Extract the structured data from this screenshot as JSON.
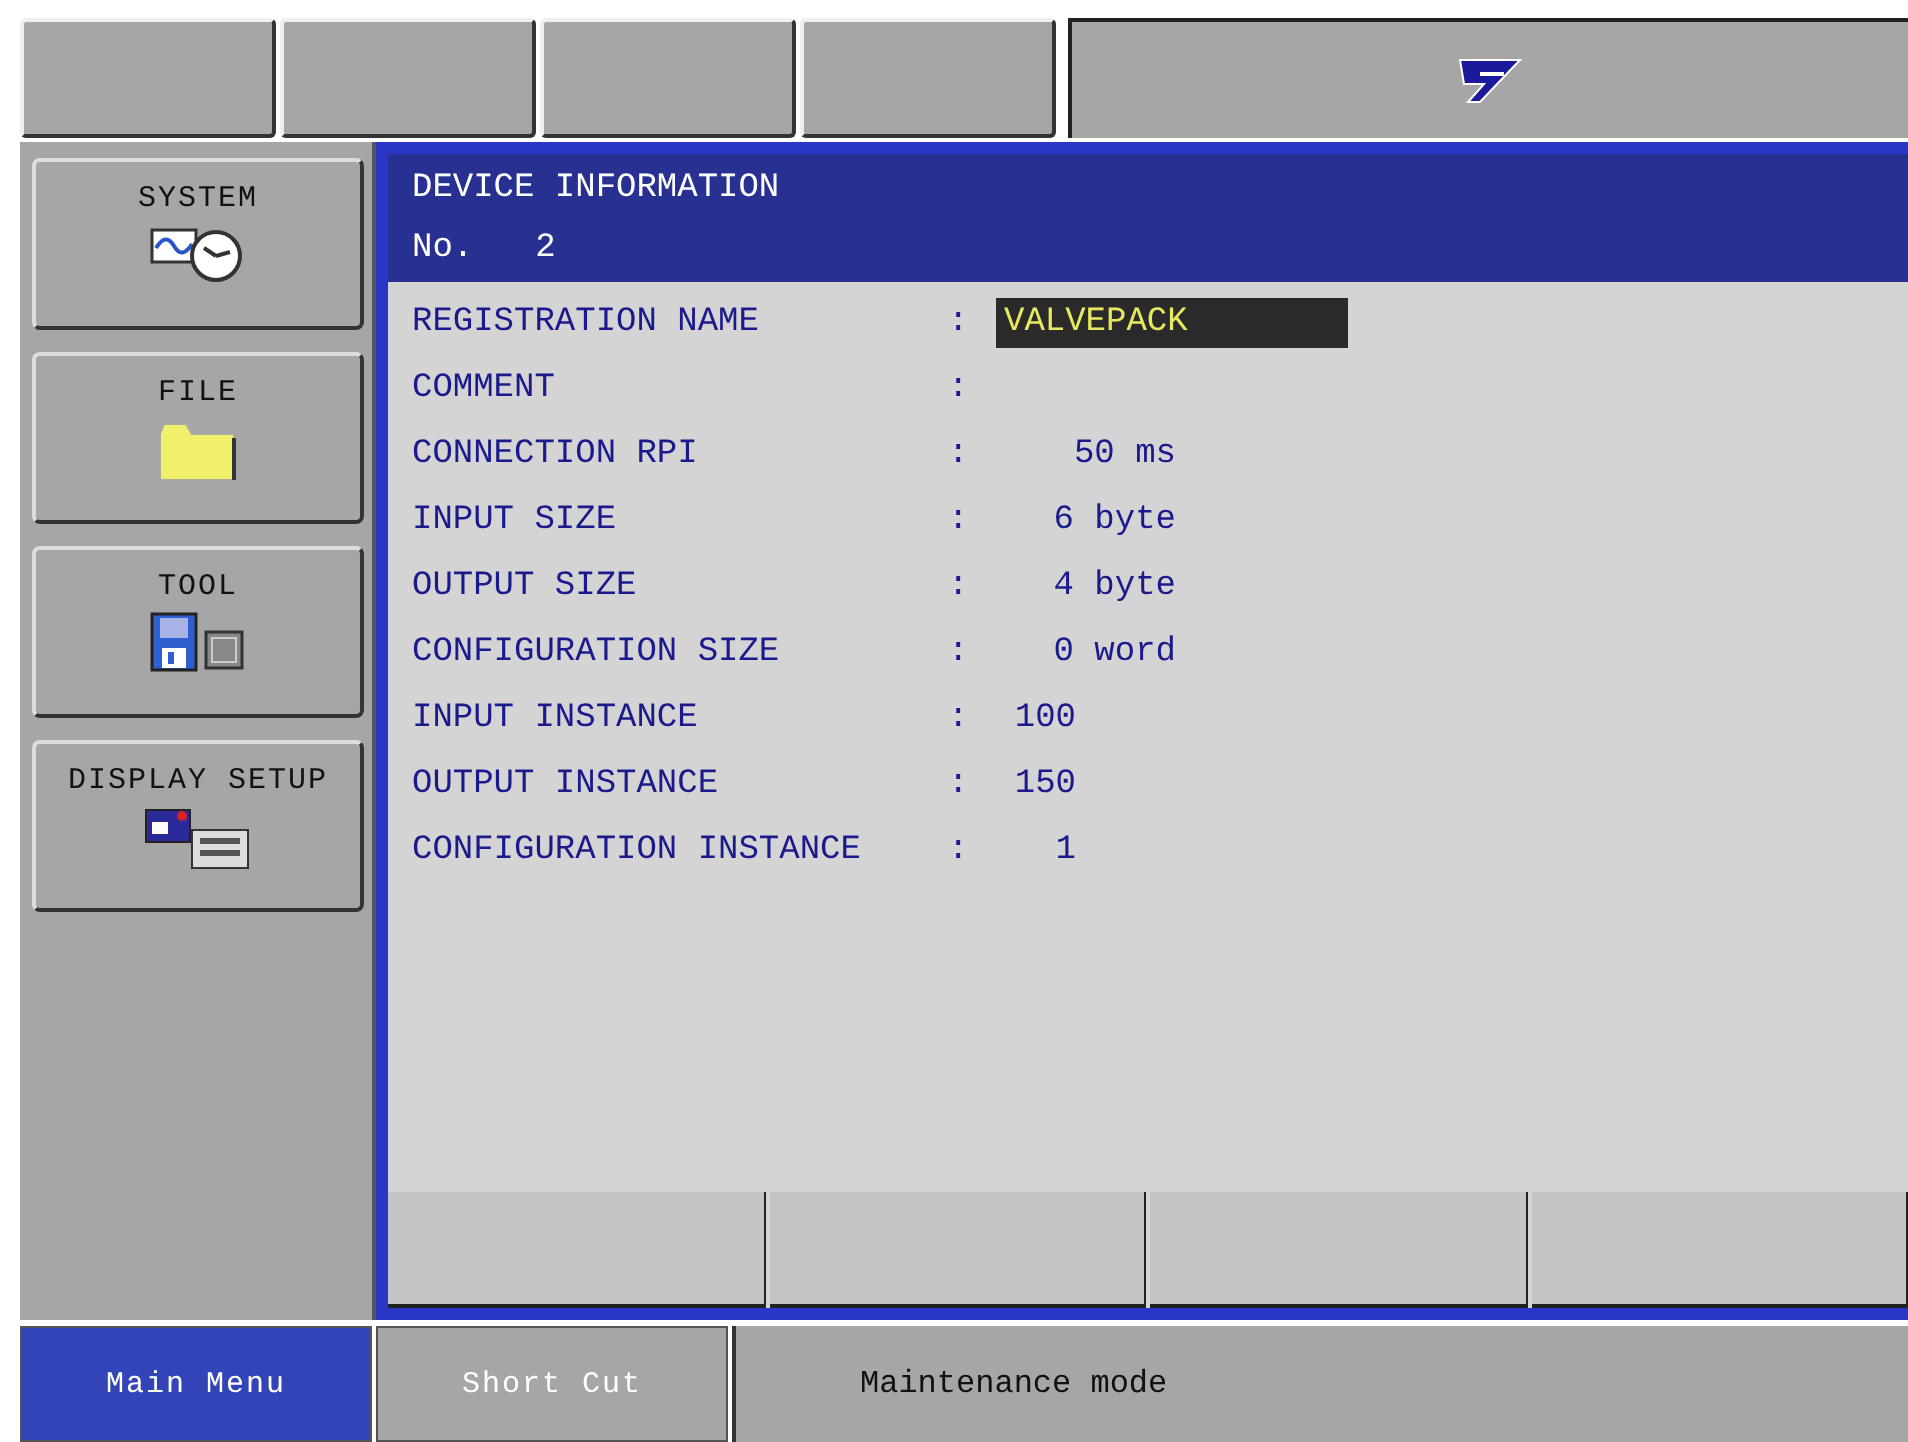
{
  "main_menu": [
    {
      "label": "SYSTEM",
      "kind": "system"
    },
    {
      "label": "FILE",
      "kind": "file"
    },
    {
      "label": "TOOL",
      "kind": "tool"
    },
    {
      "label": "DISPLAY SETUP",
      "kind": "display"
    }
  ],
  "panel": {
    "title": "DEVICE INFORMATION",
    "number_label": "No.",
    "number": "2",
    "rows": [
      {
        "label": "REGISTRATION NAME",
        "value": "VALVEPACK",
        "kind": "field"
      },
      {
        "label": "COMMENT",
        "kind": "empty"
      },
      {
        "label": "CONNECTION RPI",
        "value": "50 ms",
        "kind": "quantity"
      },
      {
        "label": "INPUT SIZE",
        "value": "6 byte",
        "kind": "quantity"
      },
      {
        "label": "OUTPUT SIZE",
        "value": "4 byte",
        "kind": "quantity"
      },
      {
        "label": "CONFIGURATION SIZE",
        "value": "0 word",
        "kind": "quantity"
      },
      {
        "label": "INPUT INSTANCE",
        "value": "100",
        "kind": "number"
      },
      {
        "label": "OUTPUT INSTANCE",
        "value": "150",
        "kind": "number"
      },
      {
        "label": "CONFIGURATION INSTANCE",
        "value": "1",
        "kind": "number"
      }
    ],
    "separator": ":"
  },
  "bottom_tabs": [
    {
      "label": "Main Menu",
      "selected": true
    },
    {
      "label": "Short Cut",
      "selected": false
    }
  ],
  "status": "Maintenance mode"
}
